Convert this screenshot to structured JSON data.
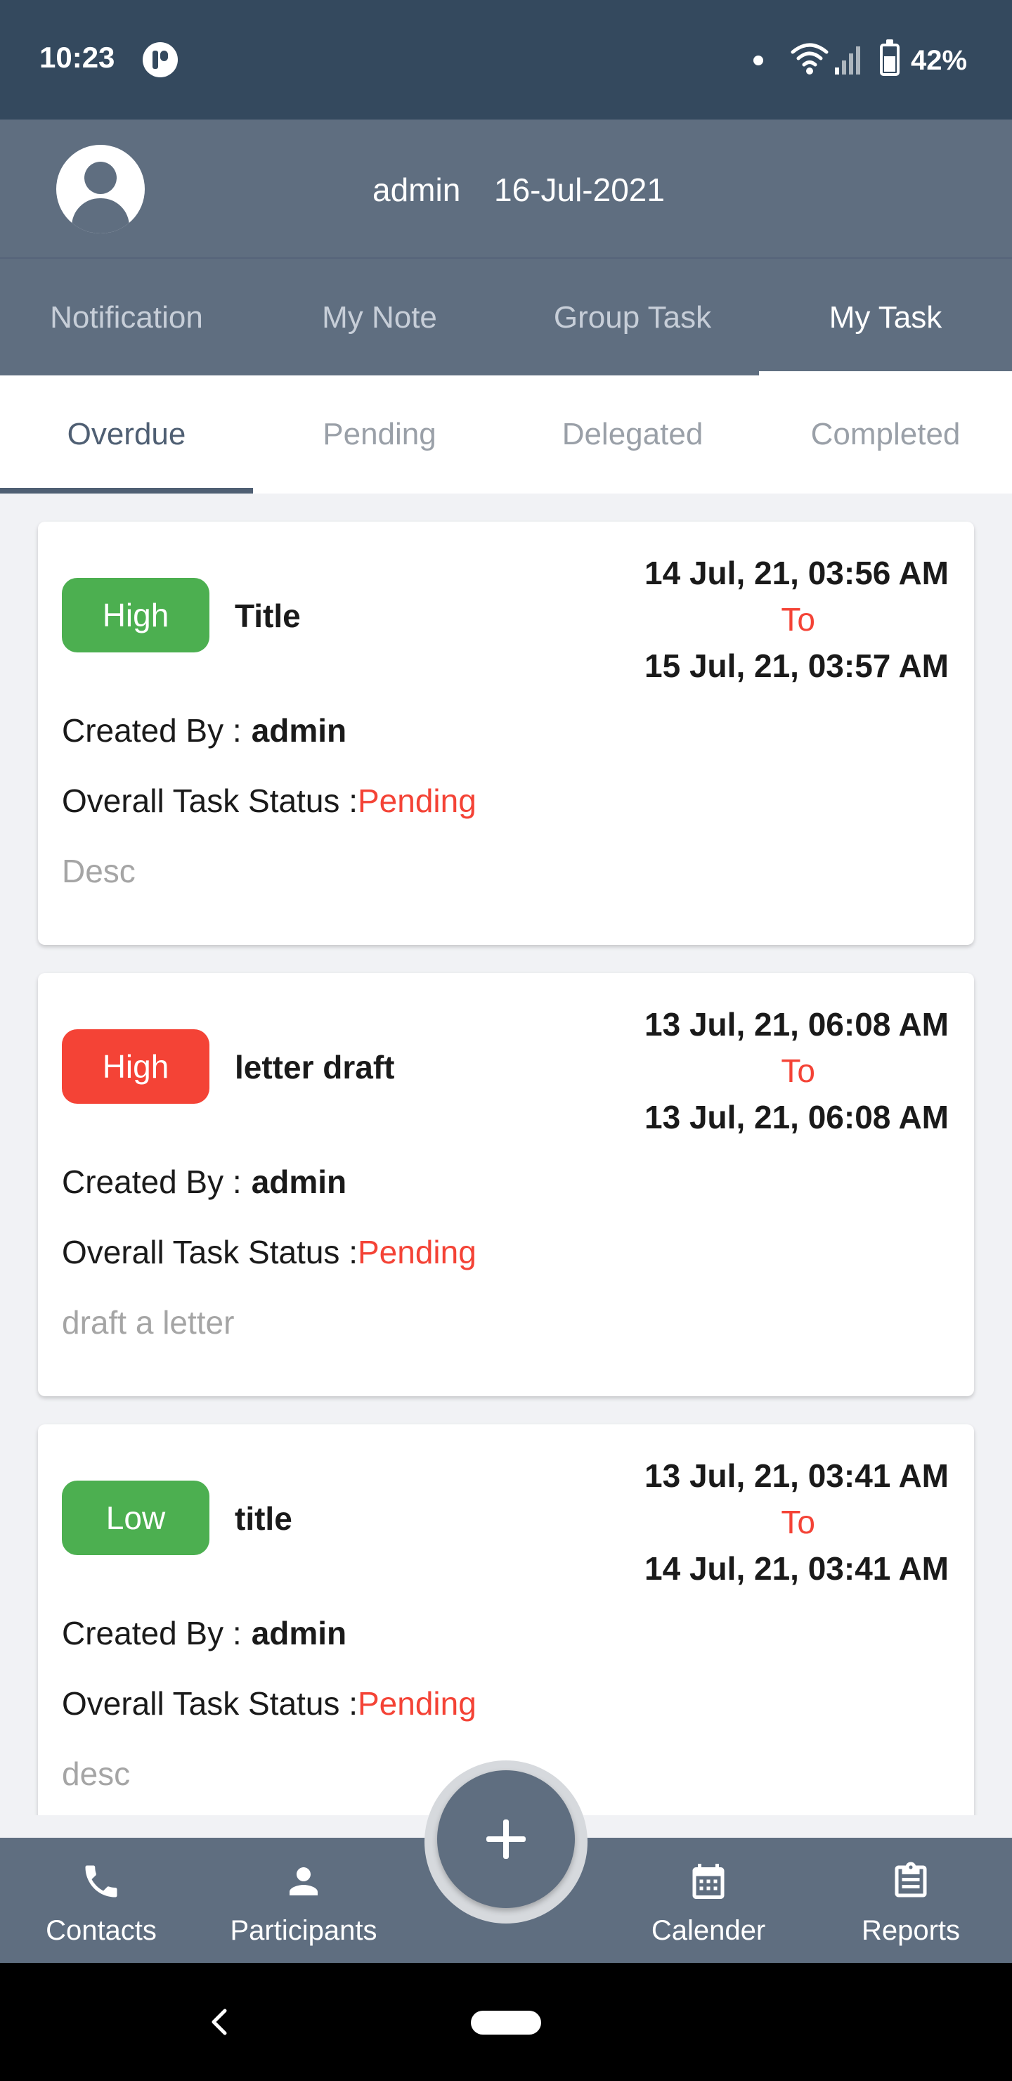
{
  "status_bar": {
    "time": "10:23",
    "battery": "42%"
  },
  "header": {
    "user": "admin",
    "date": "16-Jul-2021"
  },
  "main_tabs": [
    {
      "label": "Notification",
      "active": false
    },
    {
      "label": "My Note",
      "active": false
    },
    {
      "label": "Group Task",
      "active": false
    },
    {
      "label": "My Task",
      "active": true
    }
  ],
  "sub_tabs": [
    {
      "label": "Overdue",
      "active": true
    },
    {
      "label": "Pending",
      "active": false
    },
    {
      "label": "Delegated",
      "active": false
    },
    {
      "label": "Completed",
      "active": false
    }
  ],
  "labels": {
    "created_by": "Created By :",
    "overall_status": "Overall Task Status :",
    "to": "To"
  },
  "tasks": [
    {
      "priority": "High",
      "priority_color": "#4caf50",
      "title": "Title",
      "start": "14 Jul, 21, 03:56 AM",
      "end": "15 Jul, 21, 03:57 AM",
      "created_by": "admin",
      "status": "Pending",
      "description": "Desc"
    },
    {
      "priority": "High",
      "priority_color": "#f44336",
      "title": "letter draft",
      "start": "13 Jul, 21, 06:08 AM",
      "end": "13 Jul, 21, 06:08 AM",
      "created_by": "admin",
      "status": "Pending",
      "description": "draft a letter"
    },
    {
      "priority": "Low",
      "priority_color": "#4caf50",
      "title": "title",
      "start": "13 Jul, 21, 03:41 AM",
      "end": "14 Jul, 21, 03:41 AM",
      "created_by": "admin",
      "status": "Pending",
      "description": "desc"
    }
  ],
  "bottom_nav": [
    {
      "label": "Contacts",
      "icon": "phone-icon"
    },
    {
      "label": "Participants",
      "icon": "person-icon"
    },
    {
      "label": "Calender",
      "icon": "calendar-icon"
    },
    {
      "label": "Reports",
      "icon": "clipboard-icon"
    }
  ],
  "fab": {
    "icon": "plus-icon"
  },
  "colors": {
    "status_bar": "#34495e",
    "primary": "#5f6e80",
    "pending": "#f44336"
  }
}
